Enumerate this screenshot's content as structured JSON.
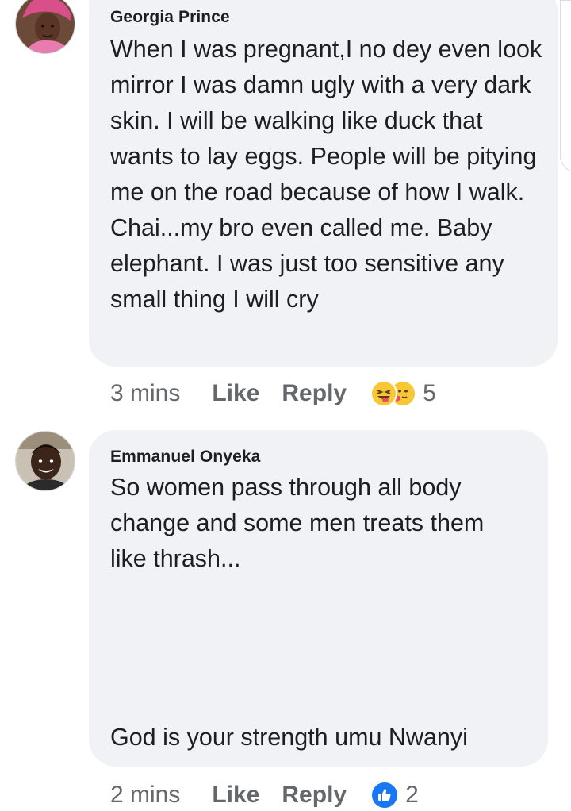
{
  "comments": [
    {
      "author": "Georgia Prince",
      "text": "When I was pregnant,I no dey even look mirror I was damn ugly with a very dark skin. I will be walking like duck that wants to lay eggs. People will be pitying me on the road because of how I walk. Chai...my bro even called me. Baby elephant. I was just too sensitive any small thing I will cry",
      "time": "3 mins",
      "like_label": "Like",
      "reply_label": "Reply",
      "reactions": [
        "laughing-tongue-emoji",
        "heart-hug-emoji"
      ],
      "reaction_count": "5"
    },
    {
      "author": "Emmanuel Onyeka",
      "text_lines": [
        "So women pass through all body",
        "change and some men treats them",
        "like thrash...",
        "God is your strength umu Nwanyi"
      ],
      "time": "2 mins",
      "like_label": "Like",
      "reply_label": "Reply",
      "reactions": [
        "thumbs-up-icon"
      ],
      "reaction_count": "2"
    }
  ]
}
